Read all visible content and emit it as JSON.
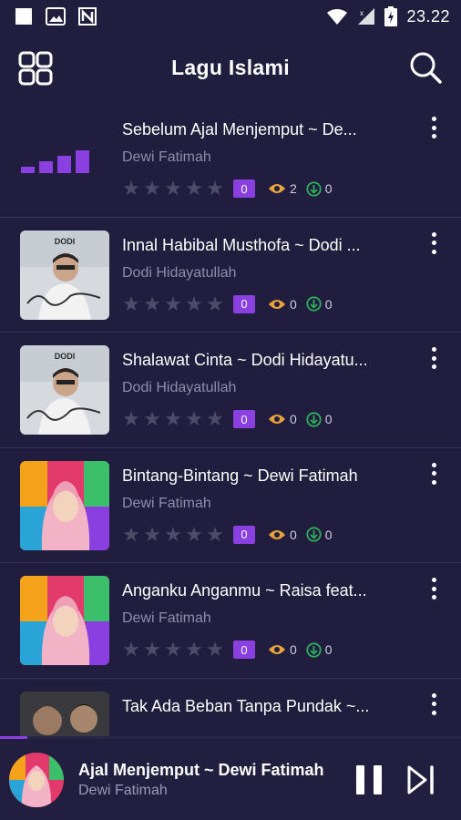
{
  "status_bar": {
    "time": "23.22"
  },
  "app_bar": {
    "title": "Lagu Islami"
  },
  "songs": [
    {
      "title": "Sebelum Ajal Menjemput ~ De...",
      "artist": "Dewi Fatimah",
      "rating_label": "0",
      "views": "2",
      "downloads": "0",
      "playing": true
    },
    {
      "title": "Innal Habibal Musthofa ~ Dodi ...",
      "artist": "Dodi Hidayatullah",
      "rating_label": "0",
      "views": "0",
      "downloads": "0"
    },
    {
      "title": "Shalawat Cinta ~ Dodi Hidayatu...",
      "artist": "Dodi Hidayatullah",
      "rating_label": "0",
      "views": "0",
      "downloads": "0"
    },
    {
      "title": "Bintang-Bintang ~ Dewi Fatimah",
      "artist": "Dewi Fatimah",
      "rating_label": "0",
      "views": "0",
      "downloads": "0"
    },
    {
      "title": "Anganku Anganmu ~ Raisa feat...",
      "artist": "Dewi Fatimah",
      "rating_label": "0",
      "views": "0",
      "downloads": "0"
    },
    {
      "title": "Tak Ada Beban Tanpa Pundak ~...",
      "artist": "",
      "rating_label": "",
      "views": "",
      "downloads": ""
    }
  ],
  "thumb_labels": {
    "dodi": "DODI"
  },
  "player": {
    "title": "Ajal Menjemput ~ Dewi Fatimah",
    "artist": "Dewi Fatimah",
    "progress": 0.06
  },
  "colors": {
    "background": "#211d3f",
    "accent": "#8a3fe0",
    "views_icon": "#e8a23a",
    "download_icon": "#2fae5a"
  },
  "icons": {
    "grid": "grid-icon",
    "search": "search-icon",
    "more": "more-vertical-icon",
    "pause": "pause-icon",
    "next": "skip-next-icon",
    "eye": "eye-icon",
    "download": "download-icon",
    "star": "star-icon"
  }
}
